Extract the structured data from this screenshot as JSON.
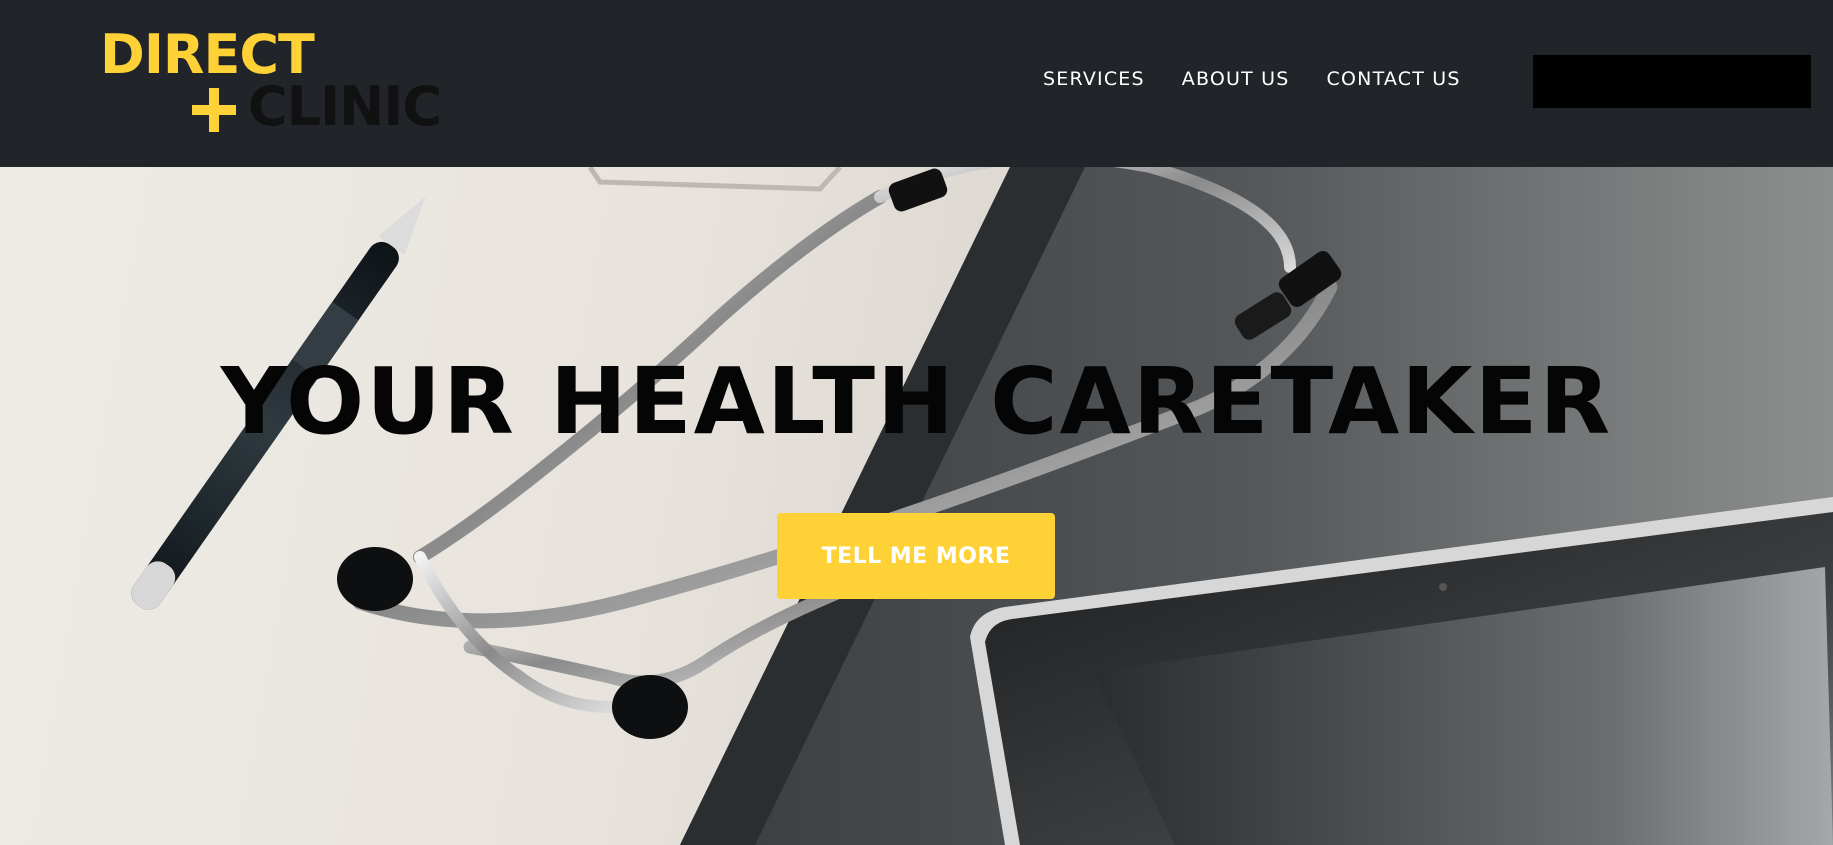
{
  "brand": {
    "name_line1": "DIRECT",
    "name_line2": "CLINIC",
    "icon": "plus-icon",
    "color_primary": "#fed136",
    "color_secondary": "#111111"
  },
  "nav": {
    "items": [
      {
        "label": "SERVICES"
      },
      {
        "label": "ABOUT US"
      },
      {
        "label": "CONTACT US"
      }
    ],
    "background": "#212529"
  },
  "hero": {
    "title": "YOUR HEALTH CARETAKER",
    "button_label": "TELL ME MORE",
    "button_color": "#fed136"
  }
}
